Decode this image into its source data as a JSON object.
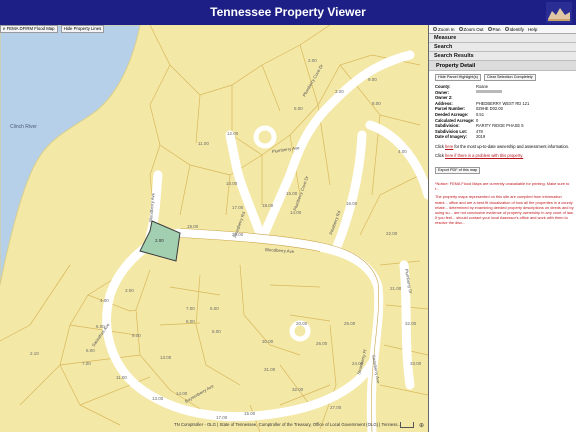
{
  "app": {
    "title": "Tennessee Property Viewer"
  },
  "map": {
    "toolbar": [
      "e FEMA DFIRM Flood Map",
      "Hide Property Lines"
    ],
    "river_label": "Clinch River",
    "roads": [
      "Plumberry Ave",
      "Plumberry Ave",
      "Plumberry Cove Dr",
      "Plumberry Cove Dr",
      "Bloodberry Ave",
      "Bloodberry Ave",
      "Pineberry Rd",
      "Pinesberry Rd",
      "Plumberry Dr",
      "Sassafras Ave",
      "Strawberry Ave",
      "Strawberry Pl",
      "Boysenberry Ave"
    ],
    "selected_lot": "2.00",
    "attribution": "TN Comptroller - OLG | State of Tennessee, Comptroller of the Treasury, Office of Local Government (OLG) | Tenness..."
  },
  "panel": {
    "toolbar": [
      "Zoom In",
      "Zoom Out",
      "Pan",
      "Identify",
      "Help"
    ],
    "sections": [
      "Measure",
      "Search",
      "Search Results"
    ],
    "detail_title": "Property Detail",
    "buttons": [
      "Hide Parcel Highlight(s)",
      "Clear Selection Completely"
    ],
    "fields": [
      {
        "label": "County:",
        "value": "Roane"
      },
      {
        "label": "Owner:",
        "value": ""
      },
      {
        "label": "Owner 2:",
        "value": ""
      },
      {
        "label": "Address:",
        "value": "PHEDBERRY WEST RD 121"
      },
      {
        "label": "Parcel Number:",
        "value": "029HE D02.00"
      },
      {
        "label": "Deeded Acreage:",
        "value": "0.51"
      },
      {
        "label": "Calculated Acreage:",
        "value": "0"
      },
      {
        "label": "Subdivision:",
        "value": "RARITY RIDGE PHASE 5"
      },
      {
        "label": "Subdivision Lot:",
        "value": "478"
      },
      {
        "label": "Date of Imagery:",
        "value": "2019"
      }
    ],
    "link1_pre": "Click",
    "link1_link": "here",
    "link1_post": "for the most up-to-date ownership and assessment information.",
    "link2_pre": "Click",
    "link2_link": "here if there is a problem with this property.",
    "export_label": "Export PDF of this map",
    "notice1": "*Notice: FEMA Flood Maps are currently unavailable for printing. Make sure to t...",
    "notice2": "The property maps represented on this site are compiled from information maint... office and are a best fit visualization of how all the properties in a county relate... determined by examining deeded property descriptions on deeds and by using su... are not conclusive evidence of property ownership in any court of law. If you feel... should contact your local Assessor's office and work with them to resolve the disc..."
  },
  "colors": {
    "header": "#1d1f86",
    "map_land": "#f4e8a6",
    "water": "#b6d0e9",
    "selected": "#a2cfb0",
    "notice": "#c0141b"
  }
}
